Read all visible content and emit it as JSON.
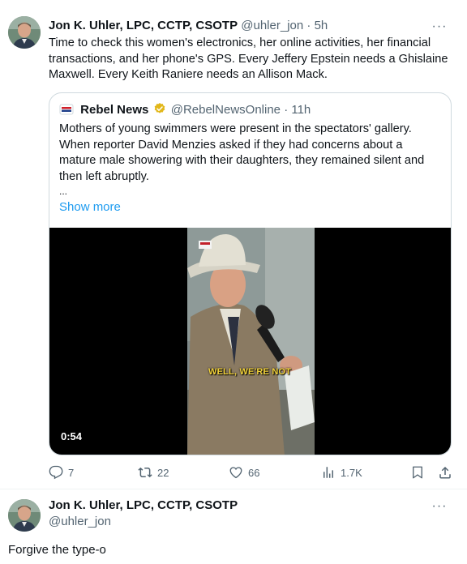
{
  "tweet1": {
    "author_name": "Jon K. Uhler, LPC, CCTP, CSOTP",
    "handle": "@uhler_jon",
    "separator": "·",
    "time": "5h",
    "more": "···",
    "text": "Time to check this women's electronics, her online activities, her financial transactions, and her phone's GPS. Every Jeffery  Epstein needs a Ghislaine Maxwell. Every Keith Raniere needs an Allison Mack.",
    "quote": {
      "author_name": "Rebel News",
      "handle": "@RebelNewsOnline",
      "separator": "·",
      "time": "11h",
      "text": "Mothers of young swimmers were present in the spectators' gallery. When reporter David Menzies asked if they had concerns about a mature male showering with their daughters, they remained silent and then left abruptly.",
      "ellipsis": "...",
      "show_more": "Show more",
      "video": {
        "caption": "WELL, WE'RE NOT",
        "duration": "0:54"
      }
    },
    "actions": {
      "replies": "7",
      "reposts": "22",
      "likes": "66",
      "views": "1.7K"
    }
  },
  "tweet2": {
    "author_name": "Jon K. Uhler, LPC, CCTP, CSOTP",
    "handle": "@uhler_jon",
    "more": "···",
    "text": "Forgive the type-o"
  },
  "colors": {
    "text": "#0f1419",
    "muted": "#536471",
    "link": "#1d9bf0",
    "border": "#cfd9de",
    "verified_gold": "#e2b719",
    "caption_yellow": "#f2d23a"
  },
  "icons": [
    "reply-icon",
    "repost-icon",
    "like-icon",
    "views-icon",
    "bookmark-icon",
    "share-icon",
    "verified-icon"
  ]
}
